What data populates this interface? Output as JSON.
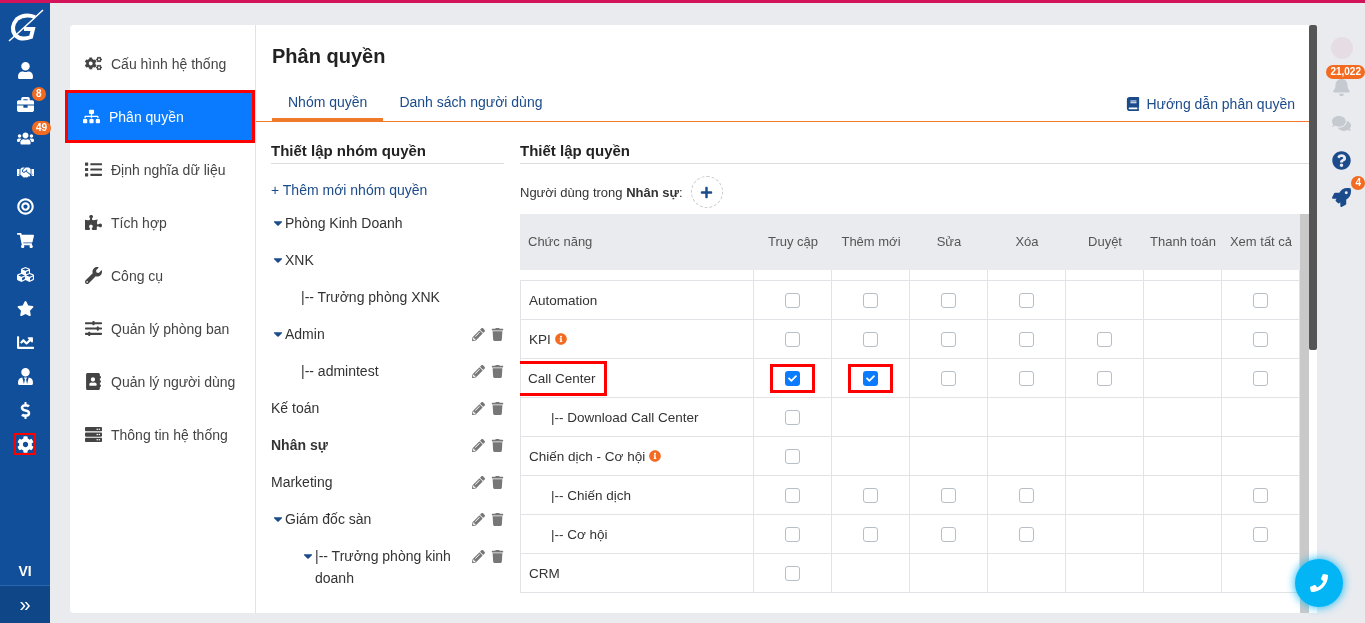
{
  "rail": {
    "items": [
      {
        "kind": "user",
        "selected": false
      },
      {
        "kind": "briefcase",
        "badge": "8",
        "selected": false
      },
      {
        "kind": "users",
        "badge": "49",
        "selected": false
      },
      {
        "kind": "handshake",
        "selected": false
      },
      {
        "kind": "target",
        "selected": false
      },
      {
        "kind": "cart",
        "selected": false
      },
      {
        "kind": "cubes",
        "selected": false
      },
      {
        "kind": "star",
        "selected": false
      },
      {
        "kind": "chart",
        "selected": false
      },
      {
        "kind": "user-tie",
        "selected": false
      },
      {
        "kind": "dollar",
        "selected": false
      },
      {
        "kind": "gear",
        "selected": true
      }
    ],
    "language": "VI",
    "expand": "»"
  },
  "settings_menu": [
    {
      "kind": "gears",
      "label": "Cấu hình hệ thống",
      "selected": false
    },
    {
      "kind": "sitemap",
      "label": "Phân quyền",
      "selected": true
    },
    {
      "kind": "list",
      "label": "Định nghĩa dữ liệu",
      "selected": false
    },
    {
      "kind": "puzzle",
      "label": "Tích hợp",
      "selected": false
    },
    {
      "kind": "wrench",
      "label": "Công cụ",
      "selected": false
    },
    {
      "kind": "sliders",
      "label": "Quản lý phòng ban",
      "selected": false
    },
    {
      "kind": "contact",
      "label": "Quản lý người dùng",
      "selected": false
    },
    {
      "kind": "server",
      "label": "Thông tin hệ thống",
      "selected": false
    }
  ],
  "page_title": "Phân quyền",
  "tabs": [
    {
      "label": "Nhóm quyền",
      "selected": true
    },
    {
      "label": "Danh sách người dùng",
      "selected": false
    }
  ],
  "guide_link": "Hướng dẫn phân quyền",
  "groups": {
    "title": "Thiết lập nhóm quyền",
    "add_link": "+ Thêm mới nhóm quyền",
    "items": [
      {
        "label": "Phòng Kinh Doanh",
        "expanded": true,
        "selected": false,
        "editable": false
      },
      {
        "label": "XNK",
        "expanded": true,
        "selected": false,
        "editable": false,
        "children": [
          {
            "label": "|-- Trưởng phòng XNK",
            "selected": false,
            "editable": false
          }
        ]
      },
      {
        "label": "Admin",
        "expanded": true,
        "selected": false,
        "editable": true,
        "children": [
          {
            "label": "|-- admintest",
            "selected": false,
            "editable": true
          }
        ]
      },
      {
        "label": "Kế toán",
        "selected": false,
        "editable": true
      },
      {
        "label": "Nhân sự",
        "selected": true,
        "editable": true
      },
      {
        "label": "Marketing",
        "selected": false,
        "editable": true
      },
      {
        "label": "Giám đốc sàn",
        "expanded": true,
        "selected": false,
        "editable": true,
        "children": [
          {
            "label": "|-- Trưởng phòng kinh doanh",
            "expanded": true,
            "selected": false,
            "editable": true
          }
        ]
      }
    ]
  },
  "permissions": {
    "title": "Thiết lập quyền",
    "users_label": "Người dùng trong **Nhân sự**:",
    "columns": [
      "Chức năng",
      "Truy cập",
      "Thêm mới",
      "Sửa",
      "Xóa",
      "Duyệt",
      "Thanh toán",
      "Xem tất cả"
    ],
    "rows": [
      {
        "name": "Automation",
        "info": false,
        "highlighted": false,
        "cells": [
          {
            "kind": "checkbox",
            "checked": false
          },
          {
            "kind": "checkbox",
            "checked": false
          },
          {
            "kind": "checkbox",
            "checked": false
          },
          {
            "kind": "checkbox",
            "checked": false
          },
          {
            "kind": "empty"
          },
          {
            "kind": "empty"
          },
          {
            "kind": "checkbox",
            "checked": false
          }
        ]
      },
      {
        "name": "KPI",
        "info": true,
        "highlighted": false,
        "cells": [
          {
            "kind": "checkbox",
            "checked": false
          },
          {
            "kind": "checkbox",
            "checked": false
          },
          {
            "kind": "checkbox",
            "checked": false
          },
          {
            "kind": "checkbox",
            "checked": false
          },
          {
            "kind": "checkbox",
            "checked": false
          },
          {
            "kind": "empty"
          },
          {
            "kind": "checkbox",
            "checked": false
          }
        ]
      },
      {
        "name": "Call Center",
        "info": false,
        "highlighted": true,
        "cells": [
          {
            "kind": "checkbox",
            "checked": true,
            "highlighted": true
          },
          {
            "kind": "checkbox",
            "checked": true,
            "highlighted": true
          },
          {
            "kind": "checkbox",
            "checked": false
          },
          {
            "kind": "checkbox",
            "checked": false
          },
          {
            "kind": "checkbox",
            "checked": false
          },
          {
            "kind": "empty"
          },
          {
            "kind": "checkbox",
            "checked": false
          }
        ],
        "children": [
          {
            "name": "|-- Download Call Center",
            "info": false,
            "highlighted": false,
            "cells": [
              {
                "kind": "checkbox",
                "checked": false
              },
              {
                "kind": "empty"
              },
              {
                "kind": "empty"
              },
              {
                "kind": "empty"
              },
              {
                "kind": "empty"
              },
              {
                "kind": "empty"
              },
              {
                "kind": "empty"
              }
            ]
          }
        ]
      },
      {
        "name": "Chiến dịch - Cơ hội",
        "info": true,
        "highlighted": false,
        "cells": [
          {
            "kind": "checkbox",
            "checked": false
          },
          {
            "kind": "empty"
          },
          {
            "kind": "empty"
          },
          {
            "kind": "empty"
          },
          {
            "kind": "empty"
          },
          {
            "kind": "empty"
          },
          {
            "kind": "empty"
          }
        ],
        "children": [
          {
            "name": "|-- Chiến dịch",
            "info": false,
            "highlighted": false,
            "cells": [
              {
                "kind": "checkbox",
                "checked": false
              },
              {
                "kind": "checkbox",
                "checked": false
              },
              {
                "kind": "checkbox",
                "checked": false
              },
              {
                "kind": "checkbox",
                "checked": false
              },
              {
                "kind": "empty"
              },
              {
                "kind": "empty"
              },
              {
                "kind": "checkbox",
                "checked": false
              }
            ]
          },
          {
            "name": "|-- Cơ hội",
            "info": false,
            "highlighted": false,
            "cells": [
              {
                "kind": "checkbox",
                "checked": false
              },
              {
                "kind": "checkbox",
                "checked": false
              },
              {
                "kind": "checkbox",
                "checked": false
              },
              {
                "kind": "checkbox",
                "checked": false
              },
              {
                "kind": "empty"
              },
              {
                "kind": "empty"
              },
              {
                "kind": "checkbox",
                "checked": false
              }
            ]
          }
        ]
      },
      {
        "name": "CRM",
        "info": false,
        "highlighted": false,
        "cells": [
          {
            "kind": "checkbox",
            "checked": false
          },
          {
            "kind": "empty"
          },
          {
            "kind": "empty"
          },
          {
            "kind": "empty"
          },
          {
            "kind": "empty"
          },
          {
            "kind": "empty"
          },
          {
            "kind": "empty"
          }
        ]
      }
    ]
  },
  "right_rail": {
    "notification_badge": "21,022",
    "rocket_badge": "4"
  }
}
